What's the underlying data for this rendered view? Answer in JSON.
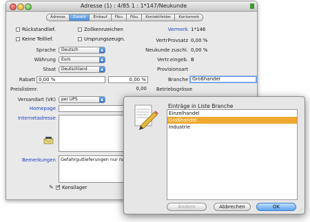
{
  "window": {
    "title": "Adresse (1) : 4/85 1 : 1*147/Neukunde"
  },
  "tabs": [
    "Adresse",
    "Zusatz",
    "Einkauf",
    "Fibu",
    "Fibu",
    "Kontaktfelder",
    "Kontomerk"
  ],
  "checkboxes": {
    "rueckstandlief": "Rückstandlief.",
    "zollkennzeichen": "Zollkennzeichen",
    "keine_teillief": "Keine Teillief.",
    "ursprungszeugn": "Ursprungszeugn.",
    "konsilager": "Konsilager"
  },
  "left": {
    "sprache": {
      "label": "Sprache",
      "value": "Deutsch"
    },
    "waehrung": {
      "label": "Währung",
      "value": "Euro"
    },
    "staat": {
      "label": "Staat",
      "value": "Deutschland"
    },
    "rabatt": {
      "label": "Rabatt",
      "value1": "0,00 %",
      "value2": "0,00 %"
    },
    "preisliste": {
      "label": "Preislistenr.",
      "value": "0,00"
    },
    "versandart": {
      "label": "Versandart (VK)",
      "value": "per UPS"
    },
    "homepage": {
      "label": "Homepage"
    },
    "internet": {
      "label": "Internetadresse"
    },
    "bemerkungen": {
      "label": "Bemerkungen",
      "value": "Gefahrgutlieferungen nur na"
    }
  },
  "right": {
    "vermerk": {
      "label": "Vermerk",
      "value": "1*146"
    },
    "vertrprovsatz": {
      "label": "VertrProvsatz",
      "value": "0,00 %"
    },
    "neukundezuschl": {
      "label": "Neukunde zuschl.",
      "value": "0,00 %"
    },
    "vertreter": {
      "label": "Vertr.eingeb.",
      "value": "B"
    },
    "provisionsart": {
      "label": "Provisionsart",
      "value": ""
    },
    "branche": {
      "label": "Branche",
      "value": "Großhandel"
    },
    "betriebsgroesse": {
      "label": "Betriebsgrösse",
      "value": ""
    }
  },
  "dialog": {
    "title": "Einträge in Liste Branche",
    "items": [
      "Einzelhandel",
      "Großhandel",
      "Industrie"
    ],
    "selected_index": 1,
    "buttons": {
      "cancel_left": "Ändern",
      "abort": "Abbrechen",
      "ok": "OK"
    }
  },
  "colors": {
    "selection": "#f0a830",
    "link_label": "#1c3fbf",
    "tab_active": "#4b8edc"
  }
}
